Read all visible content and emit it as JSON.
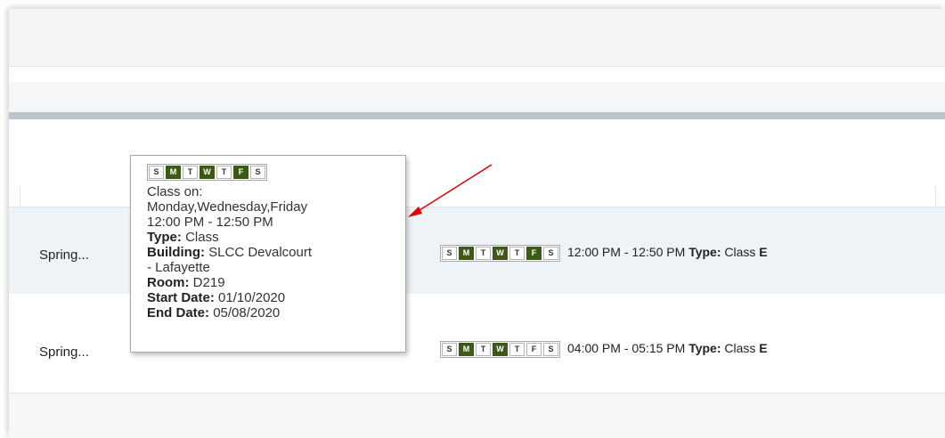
{
  "rows": [
    {
      "term": "Spring...",
      "days": [
        {
          "letter": "S",
          "active": false
        },
        {
          "letter": "M",
          "active": true
        },
        {
          "letter": "T",
          "active": false
        },
        {
          "letter": "W",
          "active": true
        },
        {
          "letter": "T",
          "active": false
        },
        {
          "letter": "F",
          "active": true
        },
        {
          "letter": "S",
          "active": false
        }
      ],
      "time": "12:00 PM - 12:50 PM",
      "type_label": "Type:",
      "type_value": "Class",
      "overflow": "E"
    },
    {
      "term": "Spring...",
      "days": [
        {
          "letter": "S",
          "active": false
        },
        {
          "letter": "M",
          "active": true
        },
        {
          "letter": "T",
          "active": false
        },
        {
          "letter": "W",
          "active": true
        },
        {
          "letter": "T",
          "active": false
        },
        {
          "letter": "F",
          "active": false
        },
        {
          "letter": "S",
          "active": false
        }
      ],
      "time": "04:00 PM - 05:15 PM",
      "type_label": "Type:",
      "type_value": "Class",
      "overflow": "E"
    }
  ],
  "tooltip": {
    "days": [
      {
        "letter": "S",
        "active": false
      },
      {
        "letter": "M",
        "active": true
      },
      {
        "letter": "T",
        "active": false
      },
      {
        "letter": "W",
        "active": true
      },
      {
        "letter": "T",
        "active": false
      },
      {
        "letter": "F",
        "active": true
      },
      {
        "letter": "S",
        "active": false
      }
    ],
    "class_on": "Class on:",
    "days_text": "Monday,Wednesday,Friday",
    "time": "12:00 PM - 12:50 PM",
    "type_label": "Type:",
    "type_value": "Class",
    "building_label": "Building:",
    "building_value": "SLCC Devalcourt",
    "building_value_2": "- Lafayette",
    "room_label": "Room:",
    "room_value": "D219",
    "start_label": "Start Date:",
    "start_value": "01/10/2020",
    "end_label": "End Date:",
    "end_value": "05/08/2020"
  },
  "colors": {
    "day_active": "#3c5a14",
    "annotation_arrow": "#e00000",
    "header_band": "#b9c6d2"
  }
}
